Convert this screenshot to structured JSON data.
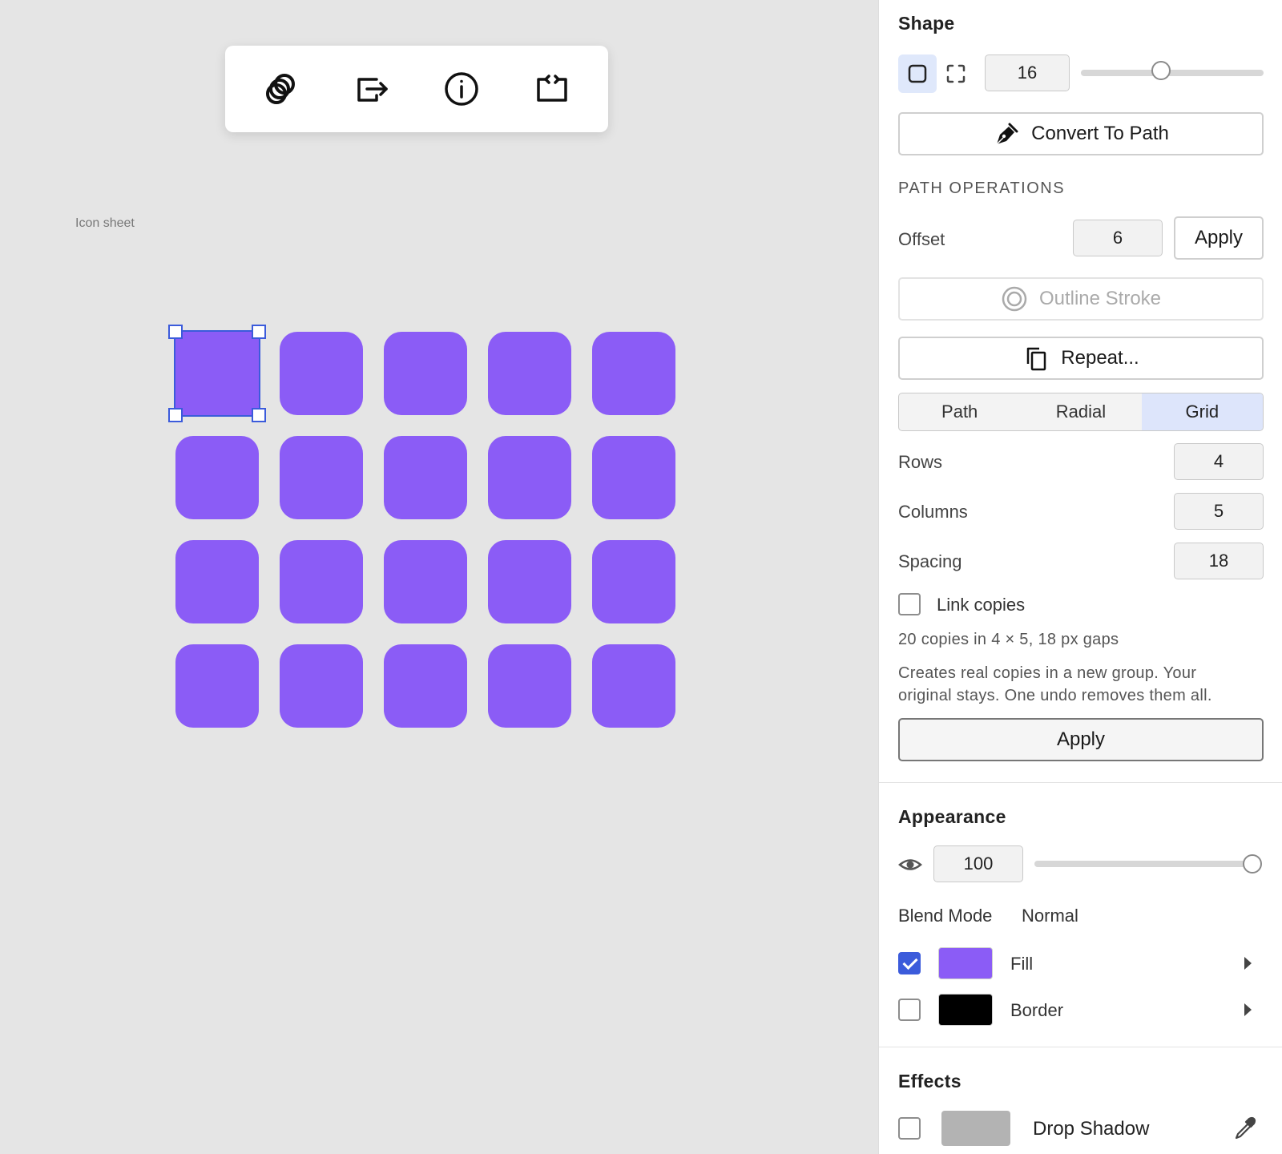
{
  "canvas": {
    "frame_label": "Icon sheet",
    "tile_color": "#8b5cf6",
    "selection_color": "#3b5bdb",
    "grid": {
      "rows": 4,
      "columns": 5
    },
    "toolbar": [
      {
        "name": "boolean-ops-icon"
      },
      {
        "name": "export-icon"
      },
      {
        "name": "info-icon"
      },
      {
        "name": "code-embed-icon"
      }
    ]
  },
  "panel": {
    "shape": {
      "title": "Shape",
      "corner_radius": "16",
      "corner_radius_slider": 0.44,
      "convert_label": "Convert To Path"
    },
    "path_ops": {
      "title": "PATH OPERATIONS",
      "offset_label": "Offset",
      "offset_value": "6",
      "offset_apply": "Apply",
      "outline_label": "Outline Stroke",
      "repeat_label": "Repeat..."
    },
    "repeat": {
      "tabs": [
        "Path",
        "Radial",
        "Grid"
      ],
      "active_tab": "Grid",
      "rows_label": "Rows",
      "rows_value": "4",
      "columns_label": "Columns",
      "columns_value": "5",
      "spacing_label": "Spacing",
      "spacing_value": "18",
      "link_copies_label": "Link copies",
      "link_copies_checked": false,
      "summary": "20 copies in 4 × 5, 18 px gaps",
      "description": "Creates real copies in a new group. Your original stays. One undo removes them all.",
      "apply_label": "Apply"
    },
    "appearance": {
      "title": "Appearance",
      "opacity_value": "100",
      "opacity_slider": 1.0,
      "blend_label": "Blend Mode",
      "blend_value": "Normal",
      "fill_label": "Fill",
      "fill_checked": true,
      "fill_color": "#8b5cf6",
      "border_label": "Border",
      "border_checked": false,
      "border_color": "#000000"
    },
    "effects": {
      "title": "Effects",
      "drop_shadow_label": "Drop Shadow",
      "drop_shadow_checked": false,
      "drop_shadow_color": "#b3b3b3"
    }
  }
}
